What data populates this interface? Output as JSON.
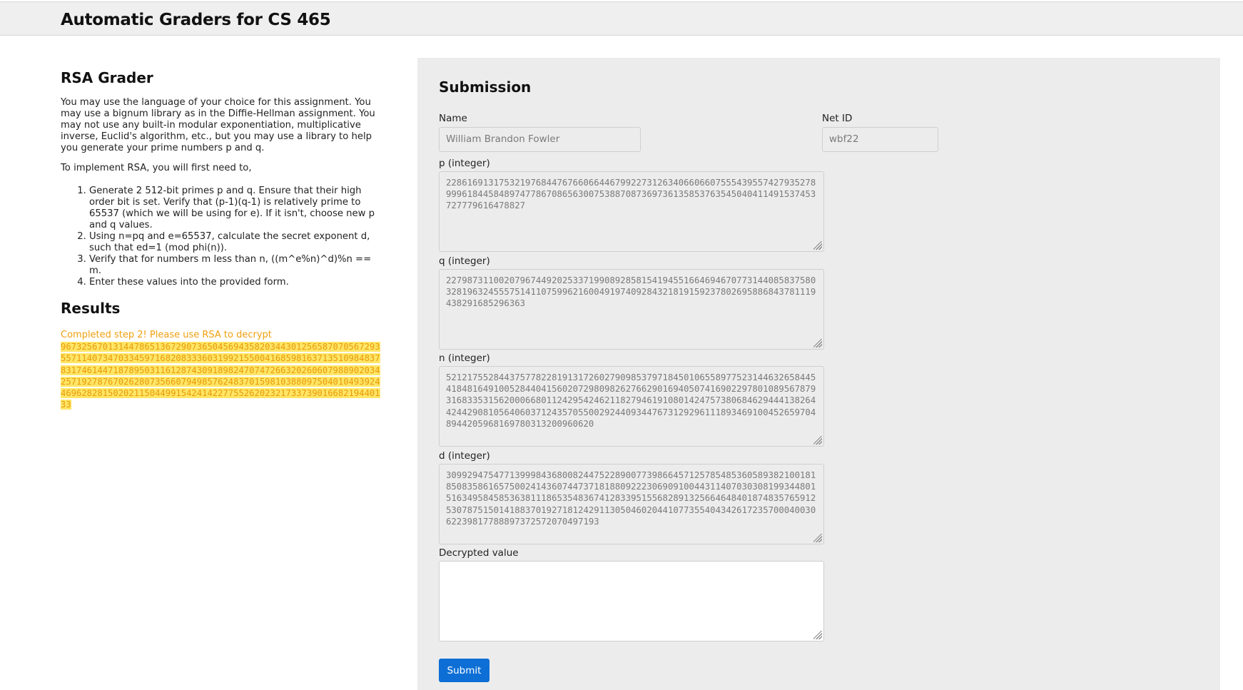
{
  "header": {
    "title": "Automatic Graders for CS 465"
  },
  "left": {
    "title": "RSA Grader",
    "intro": "You may use the language of your choice for this assignment. You may use a bignum library as in the Diffie-Hellman assignment. You may not use any built-in modular exponentiation, multiplicative inverse, Euclid's algorithm, etc., but you may use a library to help you generate your prime numbers p and q.",
    "implement": "To implement RSA, you will first need to,",
    "steps": [
      "Generate 2 512-bit primes p and q. Ensure that their high order bit is set. Verify that (p-1)(q-1) is relatively prime to 65537 (which we will be using for e). If it isn't, choose new p and q values.",
      "Using n=pq and e=65537, calculate the secret exponent d, such that ed=1 (mod phi(n)).",
      "Verify that for numbers m less than n, ((m^e%n)^d)%n == m.",
      "Enter these values into the provided form."
    ],
    "results_title": "Results",
    "results_label": "Completed step 2! Please use RSA to decrypt",
    "results_number": "9673256701314478651367290736504569435820344301256587070567293557114073470334597168208333603199215500416859816371351098483783174614471878950311612874309189824707472663202606079889020342571927876702628073566079498576248370159810388097504010493924469628281502021150449915424142277552620232173373901668219440133"
  },
  "form": {
    "title": "Submission",
    "name_label": "Name",
    "name_value": "William Brandon Fowler",
    "netid_label": "Net ID",
    "netid_value": "wbf22",
    "p_label": "p (integer)",
    "p_value": "22861691317532197684476766066446799227312634066066075554395574279352789996184458489747786708656300753887087369736135853763545040411491537453727779616478827",
    "q_label": "q (integer)",
    "q_value": "22798731100207967449202533719908928581541945516646946707731440858375803281963245557514110759962160049197409284321819159237802695886843781119438291685296363",
    "n_label": "n (integer)",
    "n_value": "52121755284437577822819131726027909853797184501065589775231446326584454184816491005284404156020729809826276629016940507416902297801089567879316833531562000668011242954246211827946191080142475738068462944413826442442908105640603712435705500292440934476731292961118934691004526597048944205968169780313200960620",
    "d_label": "d (integer)",
    "d_value": "309929475477139998436800824475228900773986645712578548536058938210018185083586165750024143607447371818809222306909100443114070303081993448015163495845853638111865354836741283395155682891325664648401874835765912530787515014188370192718124291130504602044107735540434261723570004003062239817788897372572070497193",
    "decrypted_label": "Decrypted value",
    "decrypted_value": "",
    "submit_label": "Submit"
  }
}
